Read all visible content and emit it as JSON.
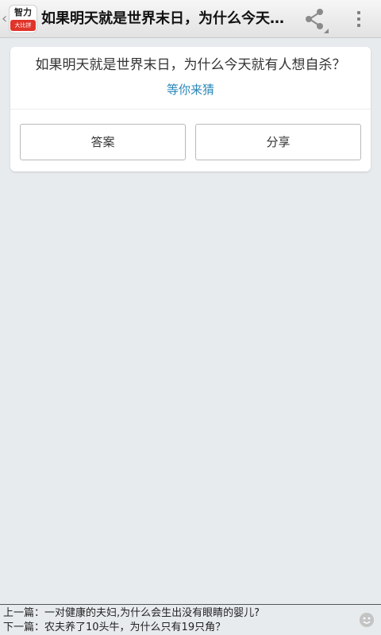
{
  "header": {
    "logo_top": "智力",
    "logo_bottom": "大比拼",
    "title": "如果明天就是世界末日，为什么今天就有人想自杀？"
  },
  "card": {
    "question": "如果明天就是世界末日，为什么今天就有人想自杀？",
    "hint": "等你来猜",
    "answer_label": "答案",
    "share_label": "分享"
  },
  "footer": {
    "prev": "上一篇：一对健康的夫妇,为什么会生出没有眼睛的婴儿?",
    "next": "下一篇：农夫养了10头牛，为什么只有19只角？"
  },
  "colors": {
    "accent": "#2a86b8",
    "background": "#e8ebee",
    "logo_red": "#e0342a"
  },
  "icons": [
    "back-chevron-icon",
    "app-logo",
    "share-icon",
    "overflow-menu-icon",
    "emoji-icon"
  ]
}
